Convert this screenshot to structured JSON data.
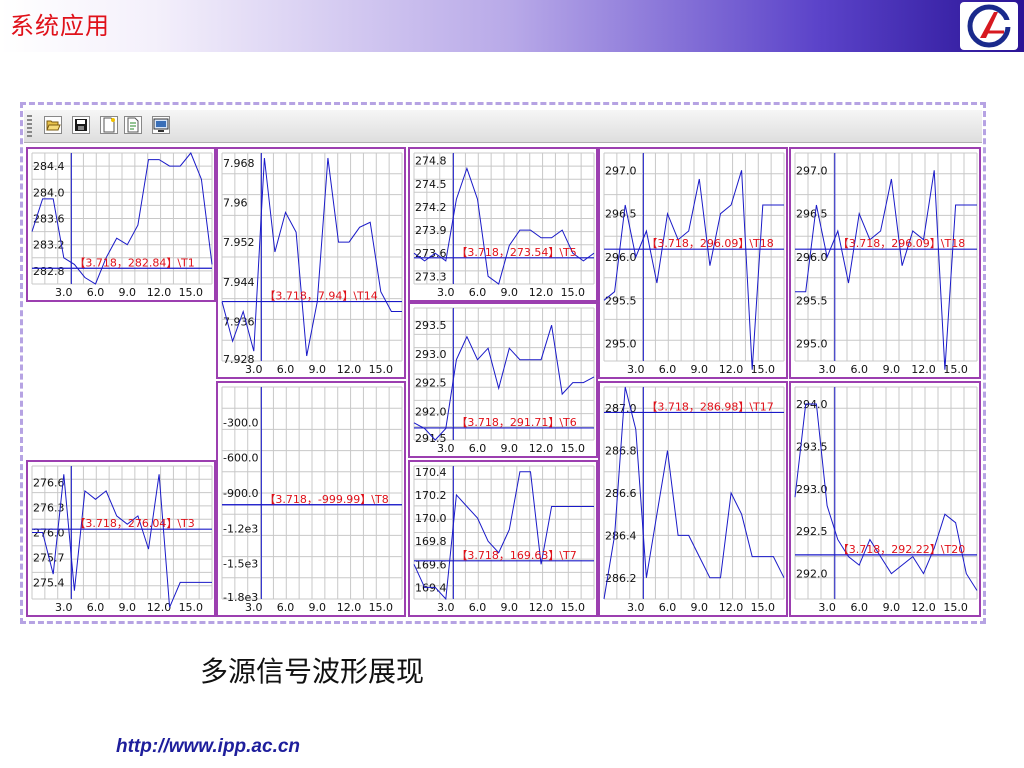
{
  "header": {
    "title": "系统应用"
  },
  "toolbar": {
    "buttons": [
      {
        "name": "open-folder-icon"
      },
      {
        "name": "save-disk-icon"
      },
      {
        "name": "new-document-icon"
      },
      {
        "name": "edit-document-icon"
      },
      {
        "name": "monitor-icon"
      }
    ]
  },
  "caption": "多源信号波形展现",
  "footer_url": "http://www.ipp.ac.cn",
  "colors": {
    "accent": "#e0111a",
    "frame": "#9c3fb0",
    "line": "#1a1ac8",
    "marker": "#e0111a"
  },
  "chart_data": [
    {
      "type": "line",
      "ylim": [
        282.6,
        284.6
      ],
      "yticks": [
        "284.4",
        "284.0",
        "283.6",
        "283.2",
        "282.8"
      ],
      "xlim": [
        0,
        17
      ],
      "xticks": [
        "3.0",
        "6.0",
        "9.0",
        "12.0",
        "15.0"
      ],
      "cursor": {
        "x": 3.718,
        "y": 282.84
      },
      "label": "【3.718，282.84】\\T1",
      "values": [
        283.4,
        283.9,
        283.9,
        283.0,
        282.9,
        282.7,
        282.6,
        283.0,
        283.3,
        283.2,
        283.5,
        284.5,
        284.5,
        284.4,
        284.4,
        284.6,
        284.2,
        282.9
      ]
    },
    {
      "type": "line",
      "ylim": [
        7.928,
        7.97
      ],
      "yticks": [
        "7.968",
        "7.96",
        "7.952",
        "7.944",
        "7.936",
        "7.928"
      ],
      "xlim": [
        0,
        17
      ],
      "xticks": [
        "3.0",
        "6.0",
        "9.0",
        "12.0",
        "15.0"
      ],
      "cursor": {
        "x": 3.718,
        "y": 7.94
      },
      "label": "【3.718，7.94】\\T14",
      "values": [
        7.94,
        7.932,
        7.938,
        7.93,
        7.969,
        7.95,
        7.958,
        7.954,
        7.929,
        7.94,
        7.969,
        7.952,
        7.952,
        7.955,
        7.956,
        7.942,
        7.938,
        7.938
      ]
    },
    {
      "type": "line",
      "ylim": [
        273.2,
        274.9
      ],
      "yticks": [
        "274.8",
        "274.5",
        "274.2",
        "273.9",
        "273.6",
        "273.3"
      ],
      "xlim": [
        0,
        17
      ],
      "xticks": [
        "3.0",
        "6.0",
        "9.0",
        "12.0",
        "15.0"
      ],
      "cursor": {
        "x": 3.718,
        "y": 273.54
      },
      "label": "【3.718，273.54】\\T5",
      "values": [
        273.6,
        273.5,
        273.6,
        273.5,
        274.3,
        274.7,
        274.3,
        273.3,
        273.2,
        273.7,
        273.9,
        273.9,
        273.8,
        273.8,
        273.9,
        273.6,
        273.5,
        273.6
      ]
    },
    {
      "type": "line",
      "ylim": [
        294.8,
        297.2
      ],
      "yticks": [
        "297.0",
        "296.5",
        "296.0",
        "295.5",
        "295.0"
      ],
      "xlim": [
        0,
        17
      ],
      "xticks": [
        "3.0",
        "6.0",
        "9.0",
        "12.0",
        "15.0"
      ],
      "cursor": {
        "x": 3.718,
        "y": 296.09
      },
      "label": "【3.718，296.09】\\T18",
      "values": [
        295.5,
        295.6,
        296.6,
        296.0,
        296.3,
        295.7,
        296.5,
        296.2,
        296.3,
        296.9,
        295.9,
        296.5,
        296.6,
        297.0,
        294.7,
        296.6,
        296.6,
        296.6
      ]
    },
    {
      "type": "line",
      "ylim": [
        294.8,
        297.2
      ],
      "yticks": [
        "297.0",
        "296.5",
        "296.0",
        "295.5",
        "295.0"
      ],
      "xlim": [
        0,
        17
      ],
      "xticks": [
        "3.0",
        "6.0",
        "9.0",
        "12.0",
        "15.0"
      ],
      "cursor": {
        "x": 3.718,
        "y": 296.09
      },
      "label": "【3.718，296.09】\\T18",
      "values": [
        295.6,
        295.6,
        296.6,
        296.0,
        296.3,
        295.7,
        296.5,
        296.2,
        296.3,
        296.9,
        295.9,
        296.3,
        296.2,
        297.0,
        294.7,
        296.6,
        296.6,
        296.6
      ]
    },
    {
      "type": "line",
      "ylim": [
        291.7,
        294.2
      ],
      "yticks": [
        "294.0",
        "293.5",
        "293.0",
        "292.5",
        "292.0"
      ],
      "xlim": [
        0,
        17
      ],
      "xticks": [
        "3.0",
        "6.0",
        "9.0",
        "12.0",
        "15.0"
      ],
      "cursor": {
        "x": 3.718,
        "y": 292.22
      },
      "label": "【3.718，292.22】\\T20",
      "values": [
        292.9,
        294.0,
        294.0,
        292.8,
        292.4,
        292.2,
        292.1,
        292.4,
        292.2,
        292.0,
        292.1,
        292.2,
        292.0,
        292.3,
        292.7,
        292.6,
        292.0,
        291.8
      ]
    },
    {
      "type": "line",
      "ylim": [
        291.5,
        293.8
      ],
      "yticks": [
        "293.5",
        "293.0",
        "292.5",
        "292.0",
        "291.5"
      ],
      "xlim": [
        0,
        17
      ],
      "xticks": [
        "3.0",
        "6.0",
        "9.0",
        "12.0",
        "15.0"
      ],
      "cursor": {
        "x": 3.718,
        "y": 291.71
      },
      "label": "【3.718，291.71】\\T6",
      "values": [
        291.8,
        291.7,
        291.5,
        291.7,
        292.9,
        293.3,
        292.9,
        293.1,
        292.4,
        293.1,
        292.9,
        292.9,
        292.9,
        293.5,
        292.3,
        292.5,
        292.5,
        292.6
      ]
    },
    {
      "type": "line",
      "ylim": [
        -1800,
        0
      ],
      "yticks": [
        "-300.0",
        "-600.0",
        "-900.0",
        "-1.2e3",
        "-1.5e3",
        "-1.8e3"
      ],
      "xlim": [
        0,
        17
      ],
      "xticks": [
        "3.0",
        "6.0",
        "9.0",
        "12.0",
        "15.0"
      ],
      "cursor": {
        "x": 3.718,
        "y": -999.99
      },
      "label": "【3.718，-999.99】\\T8",
      "values": [
        -1000,
        -1000,
        -1000,
        -1000,
        -1000,
        -1000,
        -1000,
        -1000,
        -1000,
        -1000,
        -1000,
        -1000,
        -1000,
        -1000,
        -1000,
        -1000,
        -1000,
        -1000
      ]
    },
    {
      "type": "line",
      "ylim": [
        286.1,
        287.1
      ],
      "yticks": [
        "287.0",
        "286.8",
        "286.6",
        "286.4",
        "286.2"
      ],
      "xlim": [
        0,
        17
      ],
      "xticks": [
        "3.0",
        "6.0",
        "9.0",
        "12.0",
        "15.0"
      ],
      "cursor": {
        "x": 3.718,
        "y": 286.98
      },
      "label": "【3.718，286.98】\\T17",
      "values": [
        286.1,
        286.4,
        287.1,
        286.9,
        286.2,
        286.5,
        286.8,
        286.4,
        286.4,
        286.3,
        286.2,
        286.2,
        286.6,
        286.5,
        286.3,
        286.3,
        286.3,
        286.2
      ]
    },
    {
      "type": "line",
      "ylim": [
        275.2,
        276.8
      ],
      "yticks": [
        "276.6",
        "276.3",
        "276.0",
        "275.7",
        "275.4"
      ],
      "xlim": [
        0,
        17
      ],
      "xticks": [
        "3.0",
        "6.0",
        "9.0",
        "12.0",
        "15.0"
      ],
      "cursor": {
        "x": 3.718,
        "y": 276.04
      },
      "label": "【3.718，276.04】\\T3",
      "values": [
        276.0,
        276.0,
        275.5,
        276.7,
        275.3,
        276.5,
        276.4,
        276.5,
        276.2,
        276.1,
        276.2,
        275.8,
        276.7,
        275.1,
        275.4,
        275.4,
        275.4,
        275.4
      ]
    },
    {
      "type": "line",
      "ylim": [
        169.3,
        170.45
      ],
      "yticks": [
        "170.4",
        "170.2",
        "170.0",
        "169.8",
        "169.6",
        "169.4"
      ],
      "xlim": [
        0,
        17
      ],
      "xticks": [
        "3.0",
        "6.0",
        "9.0",
        "12.0",
        "15.0"
      ],
      "cursor": {
        "x": 3.718,
        "y": 169.63
      },
      "label": "【3.718，169.63】\\T7",
      "values": [
        169.6,
        169.4,
        169.4,
        169.3,
        170.2,
        170.1,
        170.0,
        169.8,
        169.7,
        169.9,
        170.4,
        170.4,
        169.6,
        170.1,
        170.1,
        170.1,
        170.1,
        170.1
      ]
    }
  ]
}
